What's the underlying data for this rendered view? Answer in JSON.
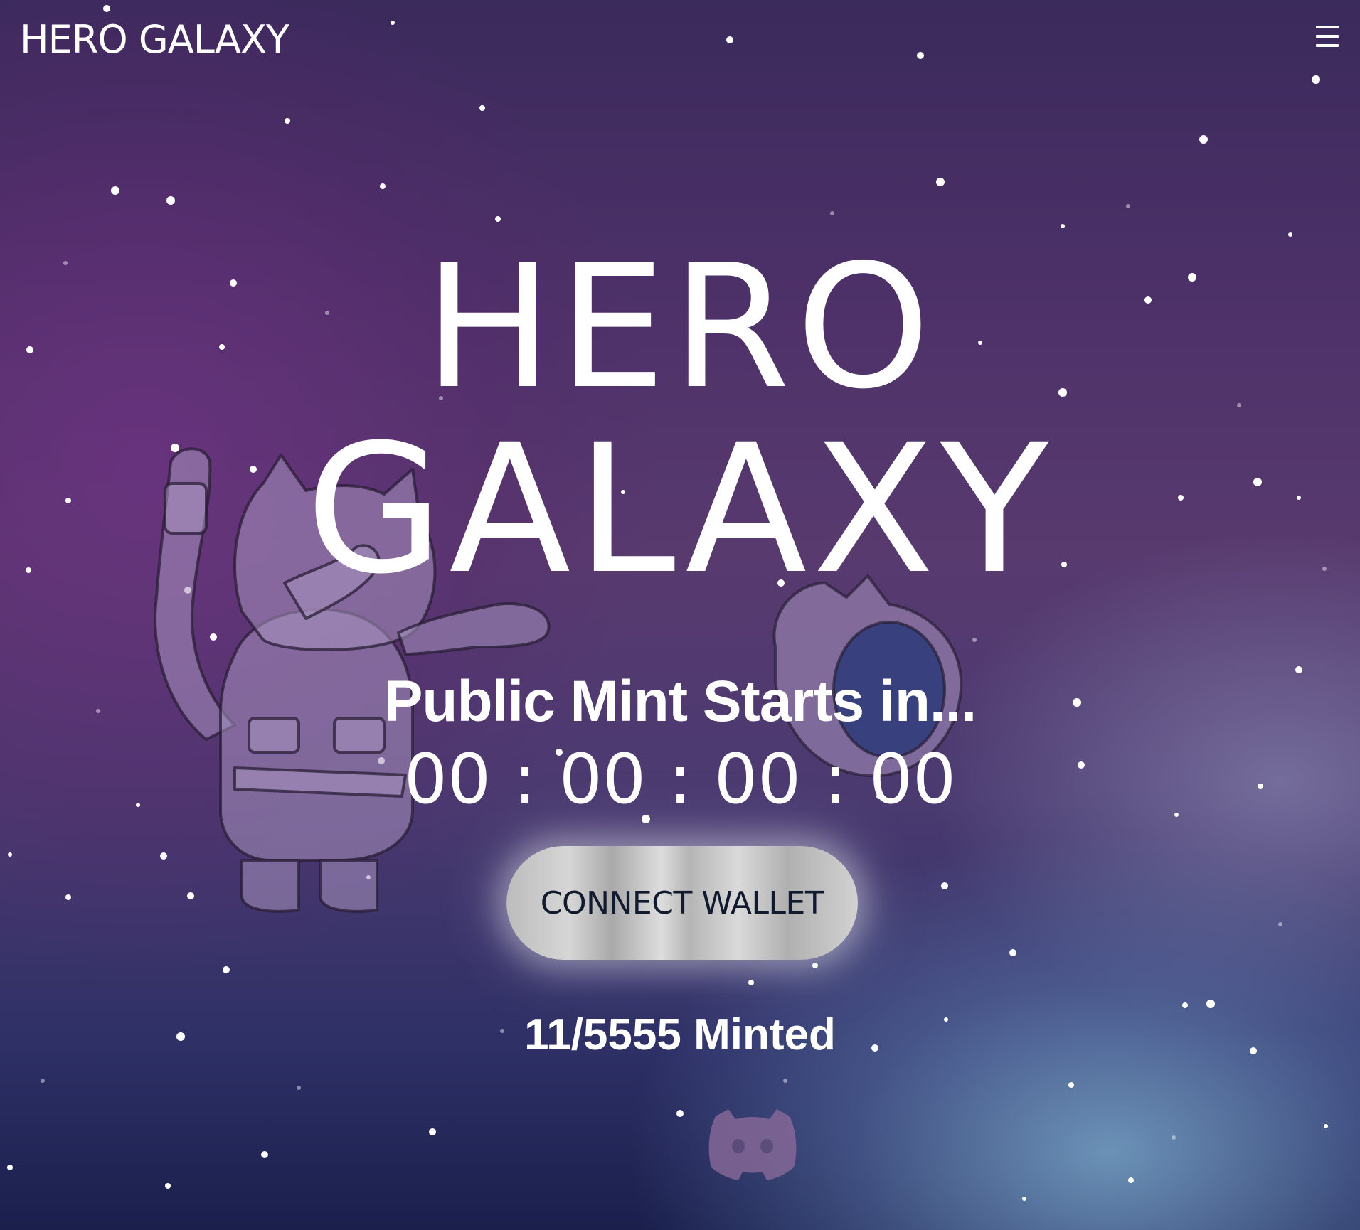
{
  "header": {
    "brand": "HERO GALAXY",
    "menu_icon": "hamburger-menu-icon"
  },
  "hero": {
    "title_line1": "HERO",
    "title_line2": "GALAXY",
    "mint_heading": "Public Mint Starts in...",
    "countdown": {
      "days": "00",
      "hours": "00",
      "minutes": "00",
      "seconds": "00",
      "separator": ":"
    },
    "connect_button_label": "CONNECT WALLET",
    "minted_text": "11/5555 Minted"
  },
  "footer": {
    "discord_icon": "discord-icon"
  },
  "colors": {
    "background_top": "#3b2a5c",
    "background_mid": "#583a6f",
    "background_bottom": "#1a1f4c",
    "text": "#ffffff",
    "button_text": "#111a2e",
    "button_silver": "#c8c8c8",
    "discord_icon": "#8a6a9a"
  }
}
